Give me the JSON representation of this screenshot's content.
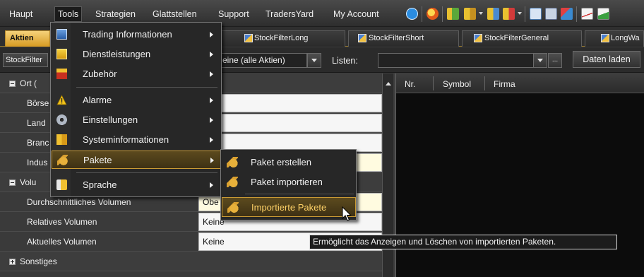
{
  "menubar": {
    "items": [
      "Haupt",
      "Tools",
      "Strategien",
      "Glattstellen",
      "Support",
      "TradersYard",
      "My Account"
    ],
    "active": "Tools",
    "toolbar_icons": [
      "info-icon",
      "globe-icon",
      "chart-up-icon",
      "chart-bars-icon",
      "chart-filter-icon",
      "chart-delete-icon",
      "table-icon",
      "list-icon",
      "pie-icon",
      "line-chart-icon",
      "area-chart-icon"
    ]
  },
  "tabs": [
    {
      "label": "Aktien",
      "active": true
    },
    {
      "label": "StockFilterLong"
    },
    {
      "label": "StockFilterShort"
    },
    {
      "label": "StockFilterGeneral"
    },
    {
      "label": "LongWa"
    }
  ],
  "filterbar": {
    "stockfilter_label": "StockFilter",
    "filter_value": "eine (alle Aktien)",
    "lists_label": "Listen:",
    "lists_value": "",
    "dots_label": "...",
    "load_button": "Daten laden"
  },
  "grid": {
    "rows": [
      {
        "type": "category",
        "label": "Ort (",
        "expanded": true
      },
      {
        "type": "property",
        "label": "Börse",
        "value": "ne"
      },
      {
        "type": "property",
        "label": "Land",
        "value": "ne"
      },
      {
        "type": "property",
        "label": "Branc",
        "value": ""
      },
      {
        "type": "property",
        "label": "Indus",
        "value": ""
      },
      {
        "type": "category",
        "label": "Volu",
        "expanded": true
      },
      {
        "type": "property",
        "label": "Durchschnittliches Volumen",
        "value": "Obe"
      },
      {
        "type": "property",
        "label": "Relatives Volumen",
        "value": "Keine"
      },
      {
        "type": "property",
        "label": "Aktuelles Volumen",
        "value": "Keine"
      },
      {
        "type": "category",
        "label": "Sonstiges",
        "expanded": false
      }
    ]
  },
  "results": {
    "columns": [
      "Nr.",
      "Symbol",
      "Firma"
    ]
  },
  "tools_menu": {
    "items": [
      {
        "label": "Trading Informationen",
        "icon": "info-book-icon",
        "submenu": true
      },
      {
        "label": "Dienstleistungen",
        "icon": "services-icon",
        "submenu": true
      },
      {
        "label": "Zubehör",
        "icon": "toolbox-icon",
        "submenu": true
      },
      {
        "label": "Alarme",
        "icon": "warning-icon",
        "submenu": true
      },
      {
        "label": "Einstellungen",
        "icon": "settings-icon",
        "submenu": true
      },
      {
        "label": "Systeminformationen",
        "icon": "system-info-icon",
        "submenu": true
      },
      {
        "label": "Pakete",
        "icon": "package-icon",
        "submenu": true,
        "selected": true
      },
      {
        "label": "Sprache",
        "icon": "language-icon",
        "submenu": true
      }
    ]
  },
  "pakete_submenu": {
    "items": [
      {
        "label": "Paket erstellen",
        "icon": "package-create-icon"
      },
      {
        "label": "Paket importieren",
        "icon": "package-import-icon"
      },
      {
        "label": "Importierte Pakete",
        "icon": "package-imported-icon",
        "selected": true
      }
    ]
  },
  "tooltip": "Ermöglicht das Anzeigen und Löschen von importierten Paketen."
}
